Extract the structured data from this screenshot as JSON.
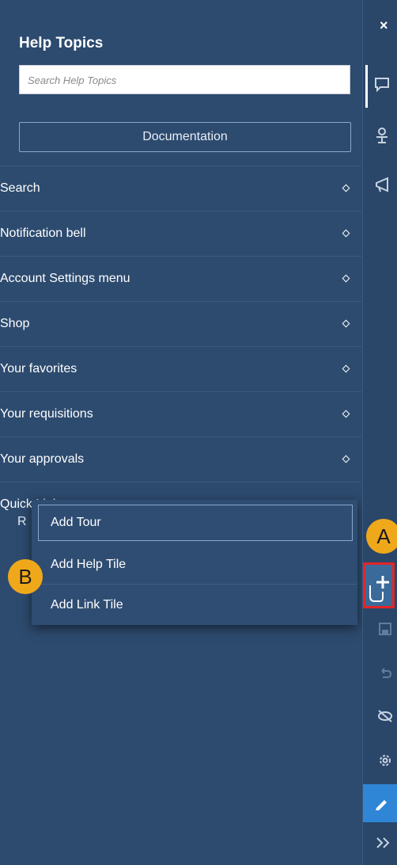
{
  "panel": {
    "title": "Help Topics",
    "search_placeholder": "Search Help Topics",
    "documentation_label": "Documentation",
    "topics": [
      {
        "label": "Search"
      },
      {
        "label": "Notification bell"
      },
      {
        "label": "Account Settings menu"
      },
      {
        "label": "Shop"
      },
      {
        "label": "Your favorites"
      },
      {
        "label": "Your requisitions"
      },
      {
        "label": "Your approvals"
      },
      {
        "label": "Quick Links"
      }
    ],
    "partial_item_letter": "R"
  },
  "add_menu": {
    "items": [
      {
        "label": "Add Tour"
      },
      {
        "label": "Add Help Tile"
      },
      {
        "label": "Add Link Tile"
      }
    ]
  },
  "callouts": {
    "a": "A",
    "b": "B"
  },
  "rail": {
    "close_glyph": "×",
    "icons": [
      "chat-bubble-icon",
      "presenter-icon",
      "megaphone-icon",
      "add-icon",
      "save-icon",
      "undo-icon",
      "hide-icon",
      "settings-icon",
      "edit-icon",
      "expand-icon"
    ]
  },
  "colors": {
    "panel_bg": "#2d4b6f",
    "callout": "#f0a81b",
    "highlight": "#e32525",
    "edit_active": "#2f86d6"
  }
}
